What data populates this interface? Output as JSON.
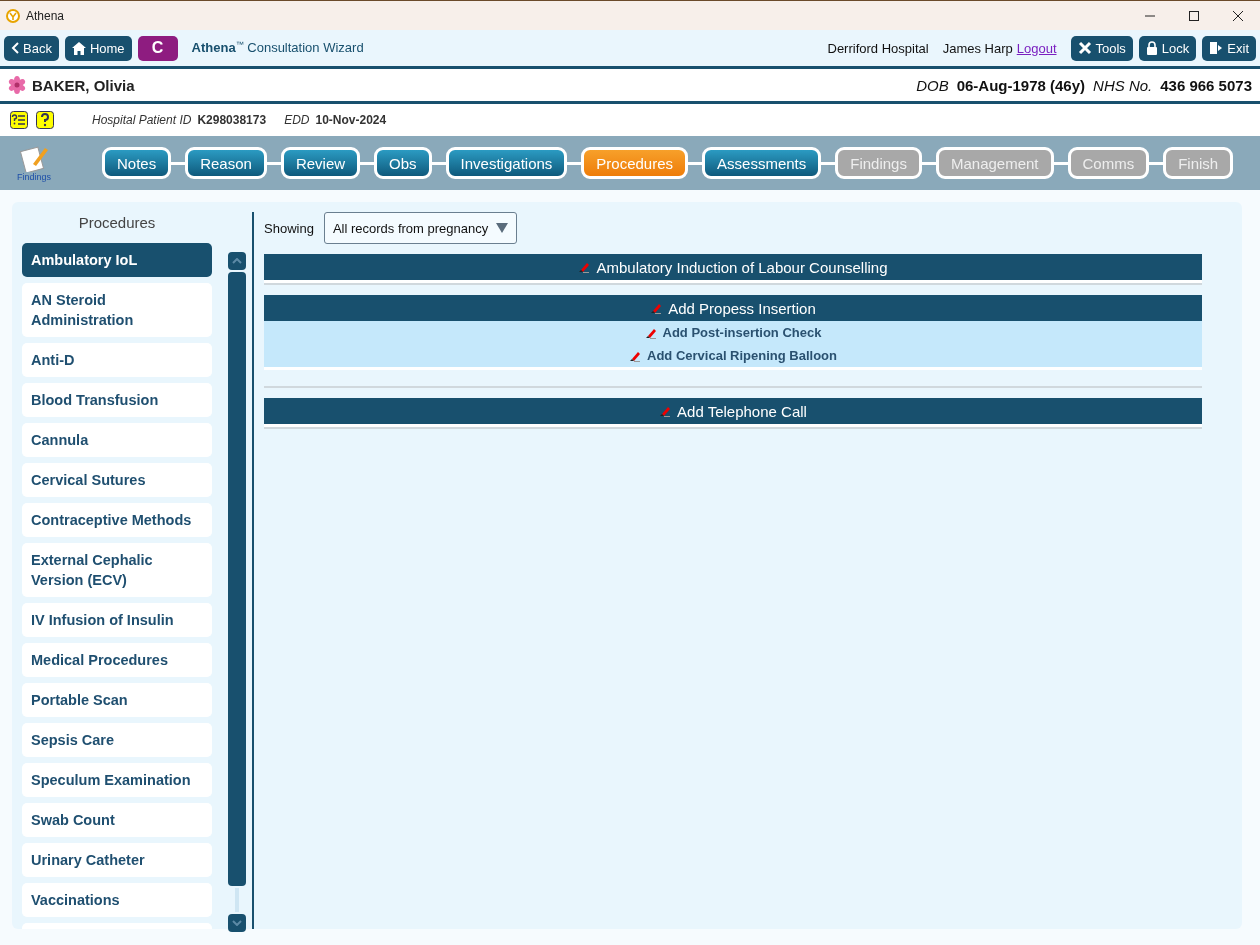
{
  "window": {
    "title": "Athena"
  },
  "toolbar": {
    "back": "Back",
    "home": "Home",
    "c_button": "C",
    "app_name": "Athena",
    "app_tm": "™",
    "app_subtitle": "Consultation Wizard",
    "hospital": "Derriford Hospital",
    "user": "James Harp",
    "logout": "Logout",
    "tools": "Tools",
    "lock": "Lock",
    "exit": "Exit"
  },
  "patient": {
    "name": "BAKER, Olivia",
    "dob_label": "DOB",
    "dob": "06-Aug-1978 (46y)",
    "nhs_label": "NHS No.",
    "nhs": "436 966 5073",
    "hospital_id_label": "Hospital Patient ID",
    "hospital_id": "K298038173",
    "edd_label": "EDD",
    "edd": "10-Nov-2024"
  },
  "wizard": {
    "icon_label": "Findings",
    "steps": [
      {
        "label": "Notes",
        "selected": false,
        "disabled": false
      },
      {
        "label": "Reason",
        "selected": false,
        "disabled": false
      },
      {
        "label": "Review",
        "selected": false,
        "disabled": false
      },
      {
        "label": "Obs",
        "selected": false,
        "disabled": false
      },
      {
        "label": "Investigations",
        "selected": false,
        "disabled": false
      },
      {
        "label": "Procedures",
        "selected": true,
        "disabled": false
      },
      {
        "label": "Assessments",
        "selected": false,
        "disabled": false
      },
      {
        "label": "Findings",
        "selected": false,
        "disabled": true
      },
      {
        "label": "Management",
        "selected": false,
        "disabled": true
      },
      {
        "label": "Comms",
        "selected": false,
        "disabled": true
      },
      {
        "label": "Finish",
        "selected": false,
        "disabled": true
      }
    ]
  },
  "sidebar": {
    "title": "Procedures",
    "items": [
      {
        "label": "Ambulatory IoL",
        "selected": true
      },
      {
        "label": "AN Steroid Administration",
        "selected": false
      },
      {
        "label": "Anti-D",
        "selected": false
      },
      {
        "label": "Blood Transfusion",
        "selected": false
      },
      {
        "label": "Cannula",
        "selected": false
      },
      {
        "label": "Cervical Sutures",
        "selected": false
      },
      {
        "label": "Contraceptive Methods",
        "selected": false
      },
      {
        "label": "External Cephalic Version (ECV)",
        "selected": false
      },
      {
        "label": "IV Infusion of Insulin",
        "selected": false
      },
      {
        "label": "Medical Procedures",
        "selected": false
      },
      {
        "label": "Portable Scan",
        "selected": false
      },
      {
        "label": "Sepsis Care",
        "selected": false
      },
      {
        "label": "Speculum Examination",
        "selected": false
      },
      {
        "label": "Swab Count",
        "selected": false
      },
      {
        "label": "Urinary Catheter",
        "selected": false
      },
      {
        "label": "Vaccinations",
        "selected": false
      }
    ]
  },
  "filter": {
    "label": "Showing",
    "value": "All records from pregnancy"
  },
  "records": [
    {
      "title": "Ambulatory Induction of Labour Counselling"
    },
    {
      "title": "Add Propess Insertion",
      "children": [
        {
          "title": "Add Post-insertion Check"
        },
        {
          "title": "Add Cervical Ripening Balloon"
        }
      ]
    },
    {
      "title": "Add Telephone Call"
    }
  ]
}
